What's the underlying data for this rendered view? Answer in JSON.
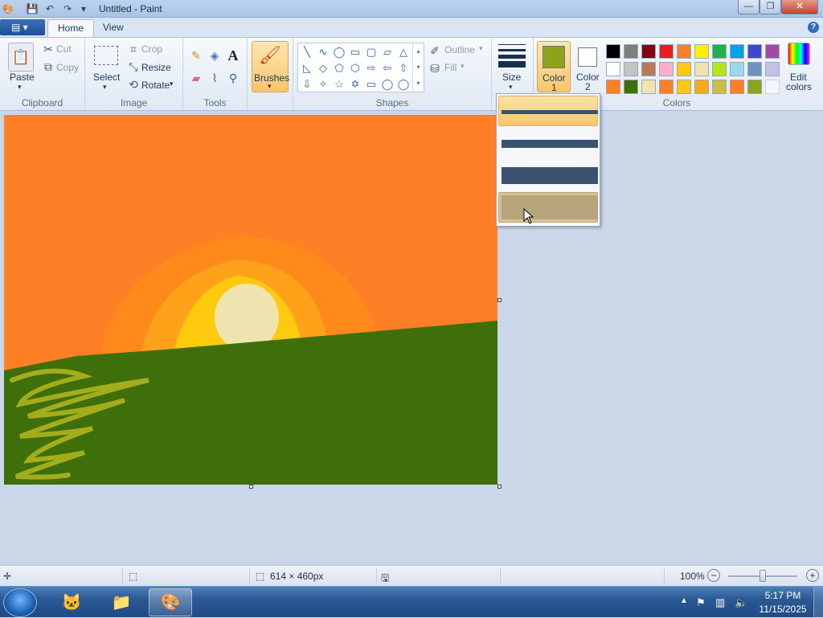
{
  "window": {
    "title": "Untitled - Paint",
    "controls": [
      "—",
      "❐",
      "✕"
    ]
  },
  "quick_access": [
    "💾",
    "↶",
    "↷",
    "▾"
  ],
  "menu": {
    "app_button": "▤ ▾",
    "tabs": [
      "Home",
      "View"
    ],
    "help": "?"
  },
  "ribbon": {
    "clipboard": {
      "label": "Clipboard",
      "paste": "Paste",
      "cut": "Cut",
      "copy": "Copy"
    },
    "image": {
      "label": "Image",
      "select": "Select",
      "crop": "Crop",
      "resize": "Resize",
      "rotate": "Rotate"
    },
    "tools": {
      "label": "Tools"
    },
    "brushes": {
      "label": "Brushes"
    },
    "shapes": {
      "label": "Shapes",
      "outline": "Outline",
      "fill": "Fill",
      "glyphs": [
        "╲",
        "∿",
        "◯",
        "▭",
        "▢",
        "▱",
        "△",
        "◺",
        "◇",
        "⬠",
        "⬡",
        "⇨",
        "⇦",
        "⇧",
        "⇩",
        "✧",
        "☆",
        "✡",
        "▭",
        "◯",
        "◯"
      ]
    },
    "size": {
      "label": "Size"
    },
    "color1": {
      "label_line1": "Color",
      "label_line2": "1",
      "value": "#8ca31a"
    },
    "color2": {
      "label_line1": "Color",
      "label_line2": "2",
      "value": "#ffffff"
    },
    "colors": {
      "label": "Colors",
      "palette_row1": [
        "#000000",
        "#7f7f7f",
        "#880015",
        "#ed1c24",
        "#ff7f27",
        "#fff200",
        "#22b14c",
        "#00a2e8",
        "#3f48cc",
        "#a349a4"
      ],
      "palette_row2": [
        "#ffffff",
        "#c3c3c3",
        "#b97a57",
        "#ffaec9",
        "#ffc90e",
        "#efe4b0",
        "#b5e61d",
        "#99d9ea",
        "#7092be",
        "#c8bfe7"
      ],
      "palette_row3": [
        "#ff7f27",
        "#3f6f0a",
        "#efe4b0",
        "#ff7f27",
        "#ffc90e",
        "#f7a81b",
        "#c8bf48",
        "#ff7f27",
        "#8ca31a",
        ""
      ]
    },
    "edit_colors": {
      "line1": "Edit",
      "line2": "colors"
    }
  },
  "size_menu": {
    "options": [
      "1px",
      "3px",
      "5px",
      "8px"
    ],
    "selected_index": 0,
    "hover_index": 3
  },
  "canvas": {
    "sky_color": "#ff7f27",
    "ground_color": "#3f6f0a",
    "sun_color": "#efe4b0"
  },
  "status": {
    "dimensions": "614 × 460px",
    "zoom": "100%",
    "zoom_fraction": 0.5
  },
  "taskbar": {
    "time": "5:17 PM",
    "date": "11/15/2025"
  }
}
